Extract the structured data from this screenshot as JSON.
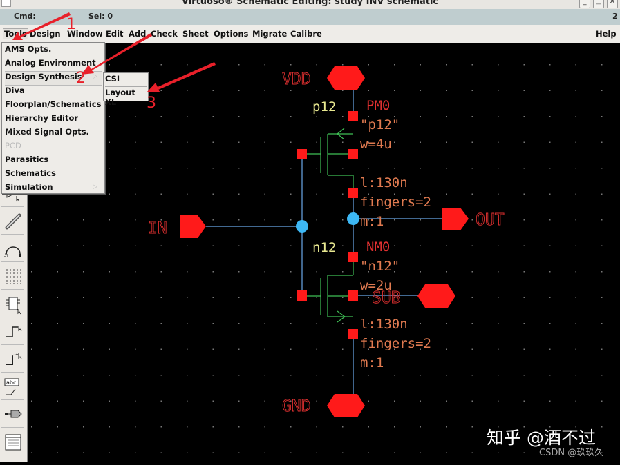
{
  "window": {
    "title": "Virtuoso® Schematic Editing: study INV schematic",
    "controls": [
      "minimize",
      "maximize",
      "close"
    ]
  },
  "status": {
    "cmd_label": "Cmd:",
    "sel_label": "Sel: 0",
    "right_value": "2"
  },
  "menubar": {
    "items": [
      "Tools",
      "Design",
      "Window",
      "Edit",
      "Add",
      "Check",
      "Sheet",
      "Options",
      "Migrate",
      "Calibre"
    ],
    "help": "Help",
    "active": "Tools"
  },
  "tools_menu": {
    "items": [
      {
        "label": "AMS Opts.",
        "enabled": true
      },
      {
        "label": "Analog Environment",
        "enabled": true
      },
      {
        "label": "Design Synthesis",
        "enabled": true,
        "submenu": true,
        "selected": true
      },
      {
        "label": "Diva",
        "enabled": true
      },
      {
        "label": "Floorplan/Schematics",
        "enabled": true
      },
      {
        "label": "Hierarchy Editor",
        "enabled": true
      },
      {
        "label": "Mixed Signal Opts.",
        "enabled": true
      },
      {
        "label": "PCD",
        "enabled": false
      },
      {
        "label": "Parasitics",
        "enabled": true
      },
      {
        "label": "Schematics",
        "enabled": true
      },
      {
        "label": "Simulation",
        "enabled": true,
        "submenu": true
      }
    ]
  },
  "design_synthesis_submenu": {
    "items": [
      "CSI",
      "Layout XL"
    ]
  },
  "annotations": {
    "step1": "1",
    "step2": "2",
    "step3": "3",
    "arrow_color": "#e8202a"
  },
  "toolbar": {
    "icons": [
      "inverter-select-icon",
      "wire-pen-icon",
      "arc-icon",
      "pin-array-icon",
      "instance-icon",
      "wire-step-icon",
      "wire-bend-icon",
      "label-icon",
      "pin-icon",
      "properties-table-icon"
    ]
  },
  "schematic": {
    "pins": {
      "vdd": "VDD",
      "gnd": "GND",
      "in": "IN",
      "out": "OUT",
      "sub": "SUB"
    },
    "pmos": {
      "cell": "p12",
      "instance": "PM0",
      "model": "\"p12\"",
      "w": "w=4u",
      "l": "l:130n",
      "fingers": "fingers=2",
      "m": "m:1"
    },
    "nmos": {
      "cell": "n12",
      "instance": "NM0",
      "model": "\"n12\"",
      "w": "w=2u",
      "l": "l:130n",
      "fingers": "fingers=2",
      "m": "m:1"
    },
    "colors": {
      "pin": "#ff1a1a",
      "pin_label": "#e03030",
      "wire": "#6aa8e8",
      "device": "#3fbf55",
      "cell_name": "#e8e890",
      "param": "#e07a50",
      "instance": "#e03030",
      "junction": "#3db8f5",
      "grid": "#777777"
    }
  },
  "watermark": {
    "main": "知乎 @酒不过",
    "sub": "CSDN @玖玖久"
  }
}
